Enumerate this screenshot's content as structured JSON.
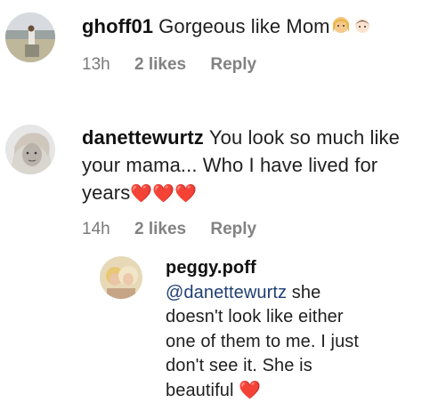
{
  "comments": [
    {
      "username": "ghoff01",
      "text": "Gorgeous like Mom",
      "emojis": [
        "person-blonde-emoji",
        "baby-girl-emoji"
      ],
      "time": "13h",
      "likes": "2 likes",
      "reply": "Reply"
    },
    {
      "username": "danettewurtz",
      "text": "You look so much like your mama... Who I have lived for years",
      "hearts": "❤️❤️❤️",
      "time": "14h",
      "likes": "2 likes",
      "reply": "Reply"
    }
  ],
  "reply_comment": {
    "username": "peggy.poff",
    "mention": "@danettewurtz",
    "text_line1": " she",
    "text_line2": "doesn't look like either",
    "text_line3": "one of them to me. I just",
    "text_line4": "don't see it. She is",
    "text_line5": "beautiful",
    "heart": "❤️"
  },
  "colors": {
    "mention": "#1f3f74",
    "meta": "#7a7a7a",
    "heart": "#e0102a"
  }
}
